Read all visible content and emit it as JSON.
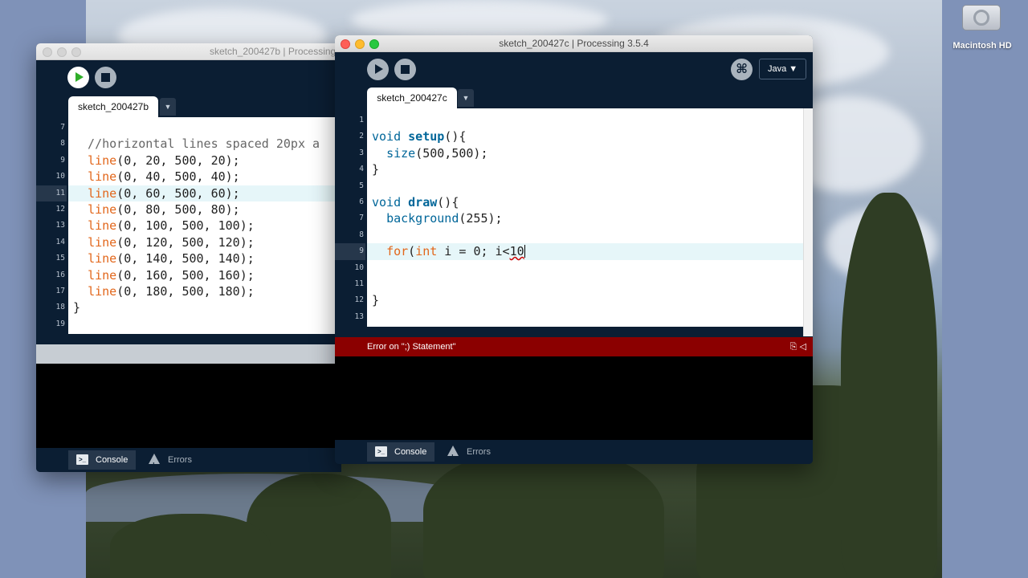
{
  "desktop": {
    "disk_label": "Macintosh HD"
  },
  "back_window": {
    "title": "sketch_200427b | Processing",
    "tab_label": "sketch_200427b",
    "tab_menu": "▼",
    "line_numbers": [
      "7",
      "8",
      "9",
      "10",
      "11",
      "12",
      "13",
      "14",
      "15",
      "16",
      "17",
      "18",
      "19"
    ],
    "comment_line": "  //horizontal lines spaced 20px a",
    "line_calls": [
      {
        "fn": "line",
        "args": "(0, 20, 500, 20);"
      },
      {
        "fn": "line",
        "args": "(0, 40, 500, 40);"
      },
      {
        "fn": "line",
        "args": "(0, 60, 500, 60);"
      },
      {
        "fn": "line",
        "args": "(0, 80, 500, 80);"
      },
      {
        "fn": "line",
        "args": "(0, 100, 500, 100);"
      },
      {
        "fn": "line",
        "args": "(0, 120, 500, 120);"
      },
      {
        "fn": "line",
        "args": "(0, 140, 500, 140);"
      },
      {
        "fn": "line",
        "args": "(0, 160, 500, 160);"
      },
      {
        "fn": "line",
        "args": "(0, 180, 500, 180);"
      }
    ],
    "closing_brace": "}",
    "console_label": "Console",
    "errors_label": "Errors",
    "console_icon": ">_"
  },
  "front_window": {
    "title": "sketch_200427c | Processing 3.5.4",
    "tab_label": "sketch_200427c",
    "tab_menu": "▼",
    "mode_label": "Java ▼",
    "debug_icon": "⌘",
    "line_numbers": [
      "1",
      "2",
      "3",
      "4",
      "5",
      "6",
      "7",
      "8",
      "9",
      "10",
      "11",
      "12",
      "13"
    ],
    "code": {
      "l2_kw": "void",
      "l2_fn": "setup",
      "l2_rest": "(){",
      "l3_indent": "  ",
      "l3_fn": "size",
      "l3_rest": "(500,500);",
      "l4": "}",
      "l6_kw": "void",
      "l6_fn": "draw",
      "l6_rest": "(){",
      "l7_indent": "  ",
      "l7_fn": "background",
      "l7_rest": "(255);",
      "l9_indent": "  ",
      "l9_for": "for",
      "l9_paren": "(",
      "l9_int": "int",
      "l9_mid": " i = ",
      "l9_zero": "0",
      "l9_after": "; i<",
      "l9_err": "10",
      "l12": "}"
    },
    "error_message": "Error on \";) Statement\"",
    "status_icons": "⎘   ◁",
    "console_label": "Console",
    "errors_label": "Errors",
    "console_icon": ">_"
  },
  "colors": {
    "editor_background": "#0b1e33",
    "keyword": "#e2661a",
    "function": "#006699",
    "error_bar": "#8b0000",
    "highlight_line": "#e6f6f9"
  }
}
